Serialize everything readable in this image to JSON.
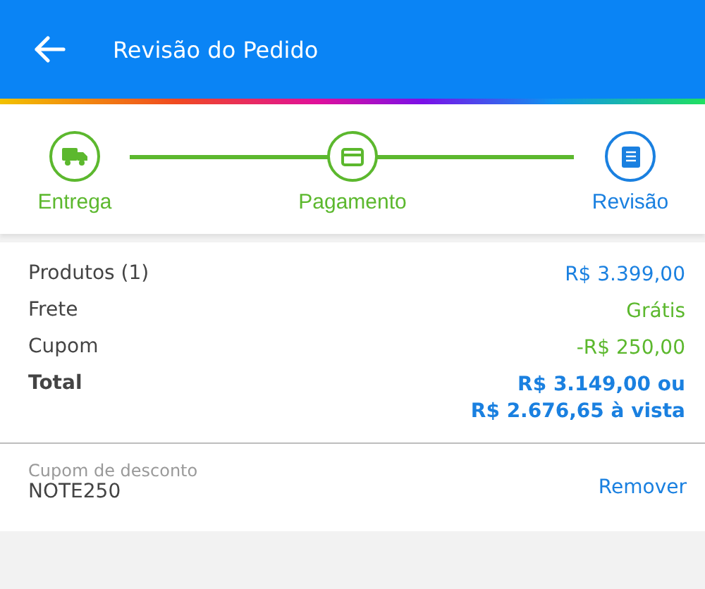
{
  "header": {
    "title": "Revisão do Pedido"
  },
  "steps": [
    {
      "label": "Entrega",
      "completed": true
    },
    {
      "label": "Pagamento",
      "completed": true
    },
    {
      "label": "Revisão",
      "completed": false
    }
  ],
  "summary": [
    {
      "kind": "line",
      "label": "Produtos (1)",
      "color": "#1a80e0",
      "values": [
        "R$ 3.399,00"
      ]
    },
    {
      "kind": "line",
      "label": "Frete",
      "color": "#5cb82e",
      "values": [
        "Grátis"
      ]
    },
    {
      "kind": "line",
      "label": "Cupom",
      "color": "#5cb82e",
      "values": [
        "-R$ 250,00"
      ]
    },
    {
      "kind": "total",
      "label": "Total",
      "color": "#1a80e0",
      "values": [
        "R$ 3.149,00 ou",
        "R$ 2.676,65 à vista"
      ]
    }
  ],
  "coupon": {
    "label": "Cupom de desconto",
    "value": "NOTE250",
    "action": "Remover"
  }
}
